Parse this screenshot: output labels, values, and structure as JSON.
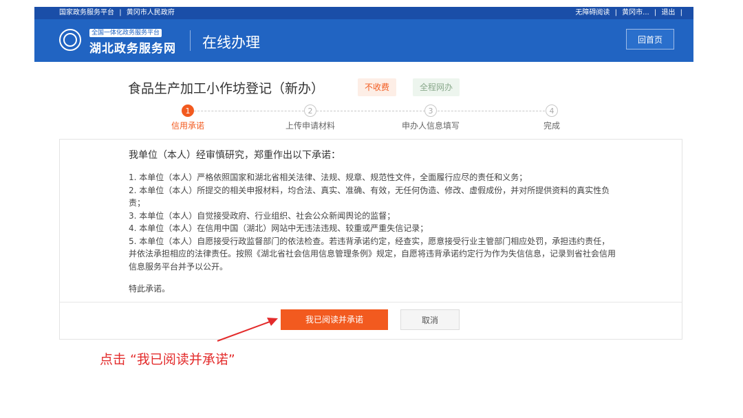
{
  "topbar": {
    "left_links": [
      "国家政务服务平台",
      "黄冈市人民政府"
    ],
    "right_links": [
      "无障碍阅读",
      "黄冈市...",
      "退出"
    ]
  },
  "header": {
    "platform_subtitle": "全国一体化政务服务平台",
    "platform_name": "湖北政务服务网",
    "section_title": "在线办理",
    "home_button": "回首页"
  },
  "page": {
    "title": "食品生产加工小作坊登记（新办）",
    "tags": [
      "不收费",
      "全程网办"
    ]
  },
  "steps": [
    {
      "num": "1",
      "label": "信用承诺",
      "active": true
    },
    {
      "num": "2",
      "label": "上传申请材料",
      "active": false
    },
    {
      "num": "3",
      "label": "申办人信息填写",
      "active": false
    },
    {
      "num": "4",
      "label": "完成",
      "active": false
    }
  ],
  "pledge": {
    "intro": "我单位（本人）经审慎研究，郑重作出以下承诺：",
    "clauses": [
      "1. 本单位（本人）严格依照国家和湖北省相关法律、法规、规章、规范性文件，全面履行应尽的责任和义务；",
      "2. 本单位（本人）所提交的相关申报材料，均合法、真实、准确、有效，无任何伪造、修改、虚假成份，并对所提供资料的真实性负责；",
      "3. 本单位（本人）自觉接受政府、行业组织、社会公众新闻舆论的监督；",
      "4. 本单位（本人）在信用中国（湖北）网站中无违法违规、较重或严重失信记录；",
      "5. 本单位（本人）自愿接受行政监督部门的依法检查。若违背承诺约定，经查实，愿意接受行业主管部门相应处罚，承担违约责任，并依法承担相应的法律责任。按照《湖北省社会信用信息管理条例》规定，自愿将违背承诺约定行为作为失信信息，记录到省社会信用信息服务平台并予以公开。"
    ],
    "closing": "特此承诺。"
  },
  "buttons": {
    "agree": "我已阅读并承诺",
    "cancel": "取消"
  },
  "annotation": {
    "text": "点击 “我已阅读并承诺”"
  },
  "colors": {
    "topbar": "#1a4ea8",
    "header": "#2164c2",
    "accent": "#f25a1f",
    "annotation": "#e32b2b"
  }
}
